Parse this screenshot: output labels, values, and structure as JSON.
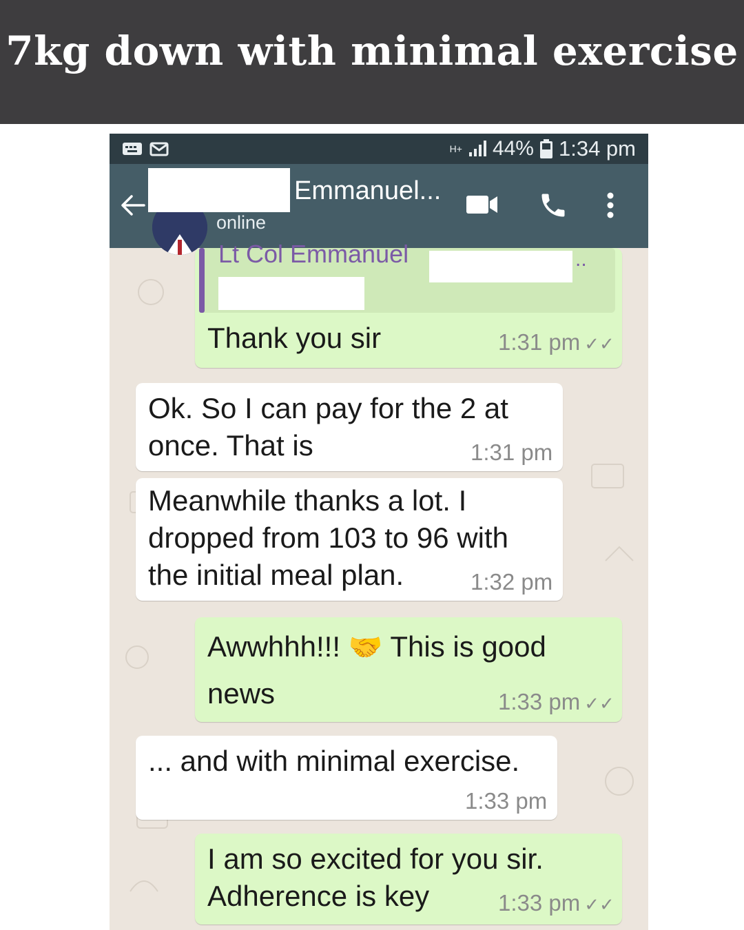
{
  "banner": {
    "title": "7kg down with minimal exercise"
  },
  "status_bar": {
    "network": "H+",
    "battery": "44%",
    "time": "1:34 pm"
  },
  "chat_header": {
    "contact_name": "Emmanuel...",
    "status": "online"
  },
  "messages": [
    {
      "direction": "outgoing",
      "quoted_sender": "Lt Col Emmanuel",
      "quoted_ellipsis": "..",
      "text": "Thank you sir",
      "time": "1:31 pm",
      "ticks": "✓✓"
    },
    {
      "direction": "incoming",
      "lines": [
        "Ok. So I can pay for the 2 at",
        "once. That is"
      ],
      "time": "1:31 pm"
    },
    {
      "direction": "incoming",
      "lines": [
        "Meanwhile thanks a lot. I",
        "dropped from 103 to 96 with",
        "the initial meal plan."
      ],
      "time": "1:32 pm"
    },
    {
      "direction": "outgoing",
      "line1_a": "Awwhhh!!!",
      "emoji": "🤝",
      "line1_b": "This is good",
      "line2": "news",
      "time": "1:33 pm",
      "ticks": "✓✓"
    },
    {
      "direction": "incoming",
      "text": "... and with minimal exercise.",
      "time": "1:33 pm"
    },
    {
      "direction": "outgoing",
      "lines": [
        "I am so excited for you sir.",
        "Adherence is key"
      ],
      "time": "1:33 pm",
      "ticks": "✓✓"
    }
  ],
  "colors": {
    "banner_bg": "#3e3d3f",
    "header_bg": "#455d67",
    "status_bg": "#2d3c43",
    "outgoing_bubble": "#dcf8c6",
    "incoming_bubble": "#ffffff",
    "chat_bg": "#ece5dd"
  }
}
